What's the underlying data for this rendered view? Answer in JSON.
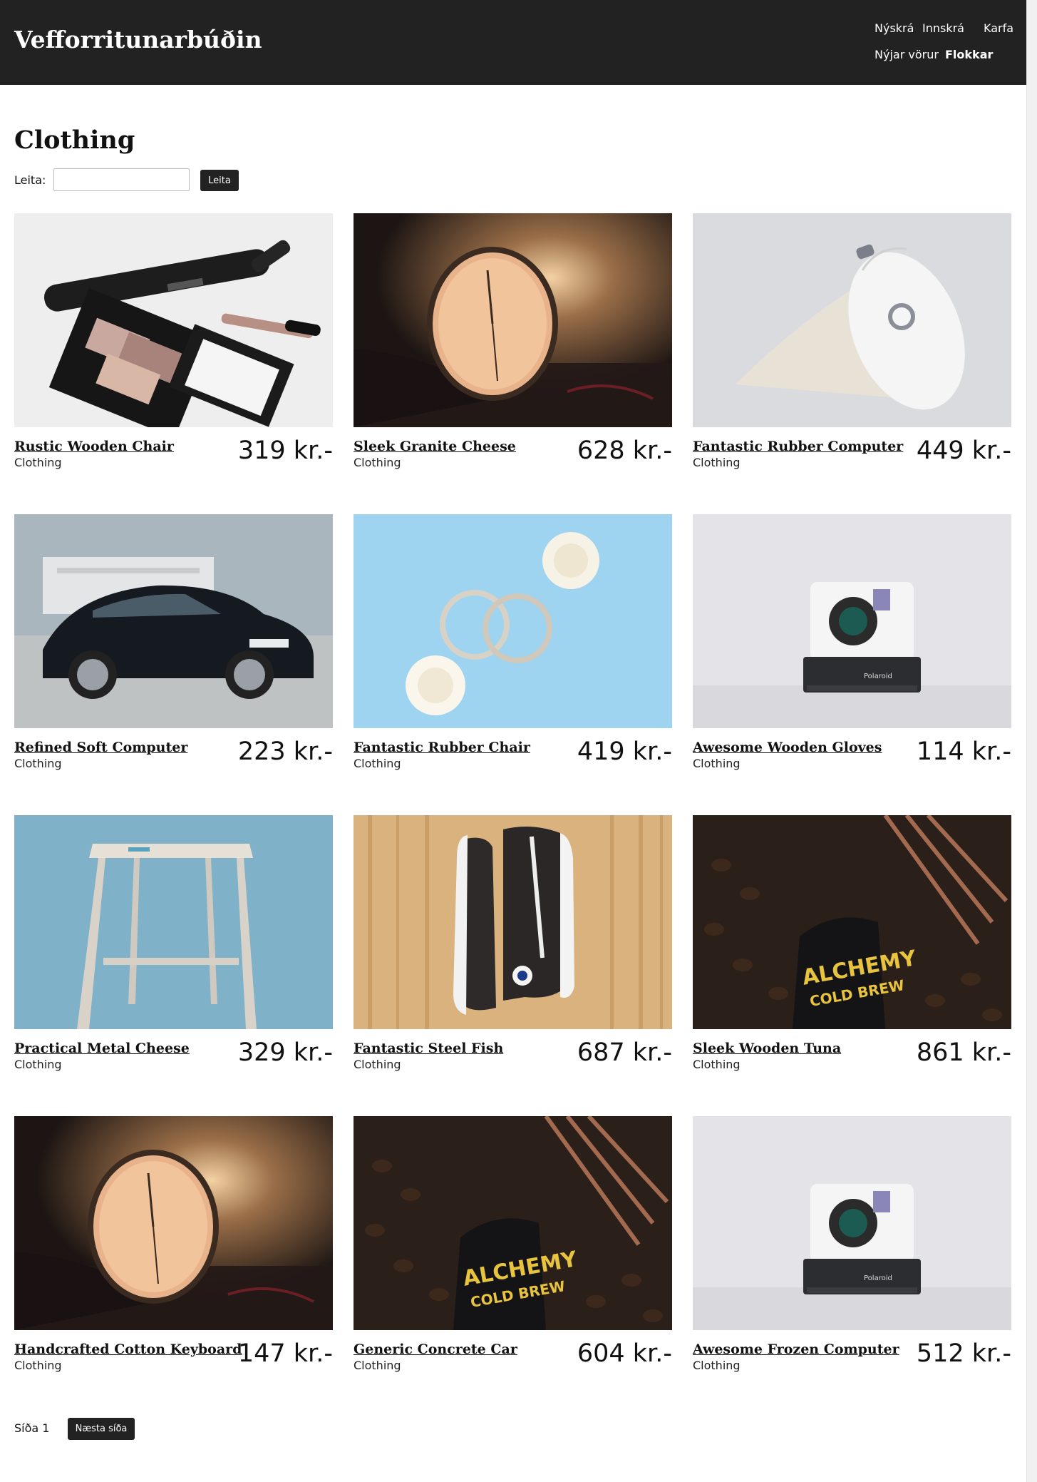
{
  "header": {
    "brand": "Vefforritunarbúðin",
    "nav": {
      "signup": "Nýskrá",
      "login": "Innskrá",
      "cart": "Karfa",
      "new_products": "Nýjar vörur",
      "categories": "Flokkar"
    }
  },
  "page": {
    "title": "Clothing",
    "search": {
      "label": "Leita:",
      "value": "",
      "placeholder": "",
      "button": "Leita"
    }
  },
  "products": [
    {
      "name": "Rustic Wooden Chair",
      "category": "Clothing",
      "price": "319 kr.-",
      "image": "hair-straightener-makeup-photo"
    },
    {
      "name": "Sleek Granite Cheese",
      "category": "Clothing",
      "price": "628 kr.-",
      "image": "wristwatch-photo"
    },
    {
      "name": "Fantastic Rubber Computer",
      "category": "Clothing",
      "price": "449 kr.-",
      "image": "white-mouse-photo"
    },
    {
      "name": "Refined Soft Computer",
      "category": "Clothing",
      "price": "223 kr.-",
      "image": "black-car-photo"
    },
    {
      "name": "Fantastic Rubber Chair",
      "category": "Clothing",
      "price": "419 kr.-",
      "image": "hoop-earrings-photo"
    },
    {
      "name": "Awesome Wooden Gloves",
      "category": "Clothing",
      "price": "114 kr.-",
      "image": "instant-camera-photo"
    },
    {
      "name": "Practical Metal Cheese",
      "category": "Clothing",
      "price": "329 kr.-",
      "image": "wooden-stool-photo"
    },
    {
      "name": "Fantastic Steel Fish",
      "category": "Clothing",
      "price": "687 kr.-",
      "image": "sneaker-photo"
    },
    {
      "name": "Sleek Wooden Tuna",
      "category": "Clothing",
      "price": "861 kr.-",
      "image": "coffee-beans-photo"
    },
    {
      "name": "Handcrafted Cotton Keyboard",
      "category": "Clothing",
      "price": "147 kr.-",
      "image": "wristwatch-photo"
    },
    {
      "name": "Generic Concrete Car",
      "category": "Clothing",
      "price": "604 kr.-",
      "image": "coffee-beans-photo"
    },
    {
      "name": "Awesome Frozen Computer",
      "category": "Clothing",
      "price": "512 kr.-",
      "image": "instant-camera-photo"
    }
  ],
  "image_text": {
    "coffee_label_1": "ALCHEMY",
    "coffee_label_2": "COLD BREW",
    "camera_label": "Polaroid"
  },
  "pagination": {
    "label": "Síða 1",
    "next": "Næsta síða"
  },
  "colors": {
    "header_bg": "#222222",
    "button_bg": "#222222",
    "text": "#111111"
  }
}
